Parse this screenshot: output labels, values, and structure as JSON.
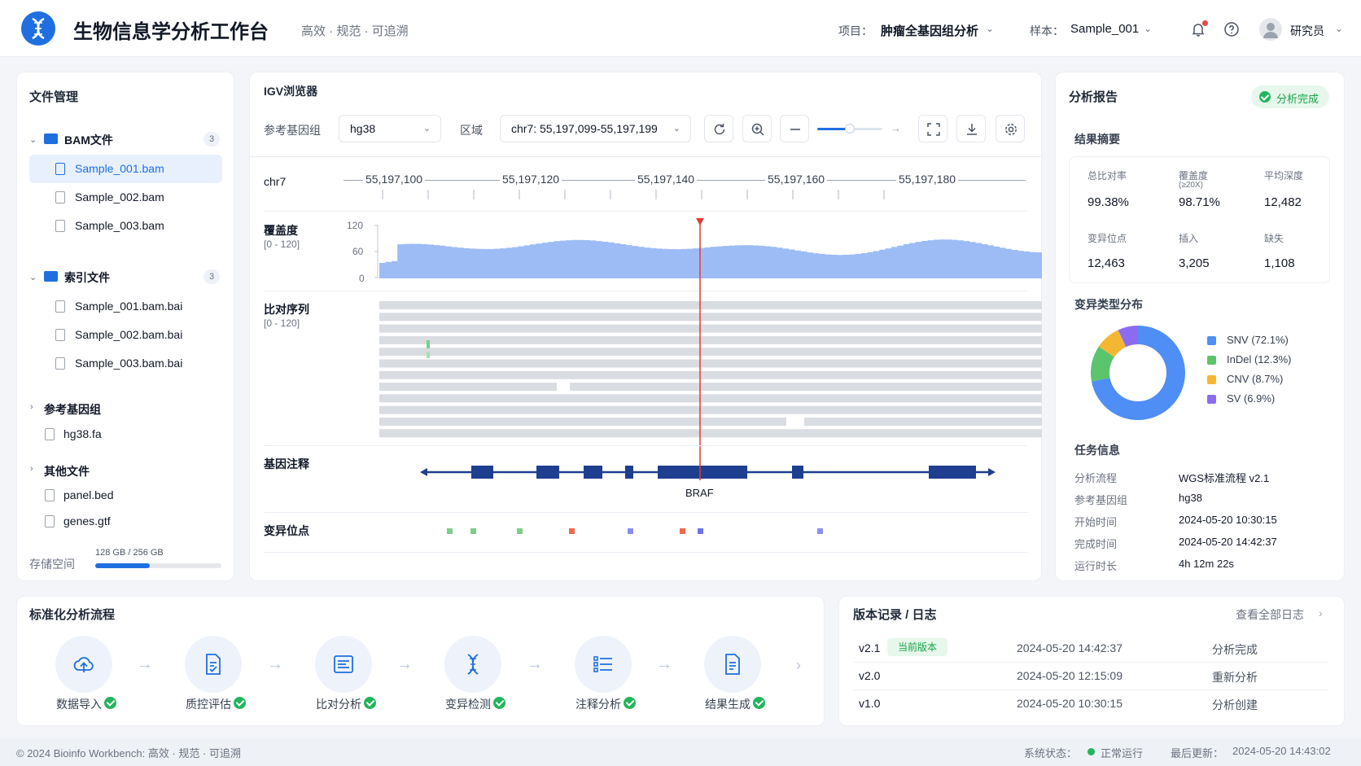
{
  "header": {
    "title": "生物信息学分析工作台",
    "subtitle": "高效 · 规范 · 可追溯",
    "project_label": "项目：",
    "project_value": "肿瘤全基因组分析",
    "sample_label": "样本：",
    "sample_value": "Sample_001",
    "user_name": "研究员",
    "icons": [
      "dna-logo-icon",
      "bell-icon",
      "help-icon",
      "user-avatar-icon",
      "chevron-down-icon"
    ]
  },
  "file_panel": {
    "title": "文件管理",
    "groups": [
      {
        "name": "BAM文件",
        "count": "3",
        "files": [
          "Sample_001.bam",
          "Sample_002.bam",
          "Sample_003.bam"
        ]
      },
      {
        "name": "索引文件",
        "count": "3",
        "files": [
          "Sample_001.bam.bai",
          "Sample_002.bam.bai",
          "Sample_003.bam.bai"
        ]
      },
      {
        "name": "参考基因组",
        "files": [
          "hg38.fa"
        ]
      },
      {
        "name": "其他文件",
        "files": [
          "panel.bed",
          "genes.gtf"
        ]
      }
    ],
    "selected_file": "Sample_001.bam",
    "storage_label": "存储空间",
    "storage_text": "128 GB / 256 GB",
    "storage_used_fraction": 0.43
  },
  "igv": {
    "title": "IGV浏览器",
    "genome_label": "参考基因组",
    "genome_value": "hg38",
    "region_label": "区域",
    "region_value": "chr7: 55,197,099-55,197,199",
    "zoom_fraction": 0.5,
    "chrom": "chr7",
    "ticks": [
      "55,197,100",
      "55,197,120",
      "55,197,140",
      "55,197,160",
      "55,197,180"
    ],
    "coverage_label": "覆盖度",
    "coverage_range": "[0 - 120]",
    "coverage_axis": [
      "120",
      "60",
      "0"
    ],
    "alignment_label": "比对序列",
    "alignment_range": "[0 - 120]",
    "gene_label": "基因注释",
    "gene_name": "BRAF",
    "variant_label": "变异位点",
    "colors": {
      "coverage": "#9dbcf5",
      "gene": "#1e3f8f",
      "cursor": "#e53935",
      "read": "#d9dce1"
    }
  },
  "report": {
    "title": "分析报告",
    "status": "分析完成",
    "summary_title": "结果摘要",
    "metrics": [
      {
        "label": "总比对率",
        "value": "99.38%"
      },
      {
        "label": "覆盖度",
        "sub": "(≥20X)",
        "value": "98.71%"
      },
      {
        "label": "平均深度",
        "value": "12,482"
      },
      {
        "label": "变异位点",
        "value": "12,463"
      },
      {
        "label": "插入",
        "value": "3,205"
      },
      {
        "label": "缺失",
        "value": "1,108"
      }
    ],
    "dist_title": "变异类型分布",
    "task_title": "任务信息",
    "task": [
      {
        "label": "分析流程",
        "value": "WGS标准流程 v2.1"
      },
      {
        "label": "参考基因组",
        "value": "hg38"
      },
      {
        "label": "开始时间",
        "value": "2024-05-20 10:30:15"
      },
      {
        "label": "完成时间",
        "value": "2024-05-20 14:42:37"
      },
      {
        "label": "运行时长",
        "value": "4h 12m 22s"
      }
    ]
  },
  "chart_data": {
    "type": "pie",
    "categories": [
      "SNV",
      "InDel",
      "CNV",
      "SV"
    ],
    "values": [
      72.1,
      12.3,
      8.7,
      6.9
    ],
    "legend": [
      "SNV (72.1%)",
      "InDel (12.3%)",
      "CNV (8.7%)",
      "SV (6.9%)"
    ],
    "colors": [
      "#4f8ef5",
      "#5cc46d",
      "#f5b731",
      "#8b6cf0"
    ],
    "legend_position": "right"
  },
  "pipeline": {
    "title": "标准化分析流程",
    "steps": [
      {
        "label": "数据导入",
        "icon": "cloud-upload-icon"
      },
      {
        "label": "质控评估",
        "icon": "qc-document-icon"
      },
      {
        "label": "比对分析",
        "icon": "alignment-icon"
      },
      {
        "label": "变异检测",
        "icon": "dna-icon"
      },
      {
        "label": "注释分析",
        "icon": "list-icon"
      },
      {
        "label": "结果生成",
        "icon": "report-icon"
      }
    ]
  },
  "versions": {
    "title": "版本记录 / 日志",
    "view_all": "查看全部日志",
    "current_badge": "当前版本",
    "rows": [
      {
        "version": "v2.1",
        "time": "2024-05-20 14:42:37",
        "action": "分析完成"
      },
      {
        "version": "v2.0",
        "time": "2024-05-20 12:15:09",
        "action": "重新分析"
      },
      {
        "version": "v1.0",
        "time": "2024-05-20 10:30:15",
        "action": "分析创建"
      }
    ]
  },
  "footer": {
    "copyright": "© 2024 Bioinfo Workbench: 高效 · 规范 · 可追溯",
    "status_label": "系统状态：",
    "status_value": "正常运行",
    "update_label": "最后更新：",
    "update_value": "2024-05-20 14:43:02"
  }
}
